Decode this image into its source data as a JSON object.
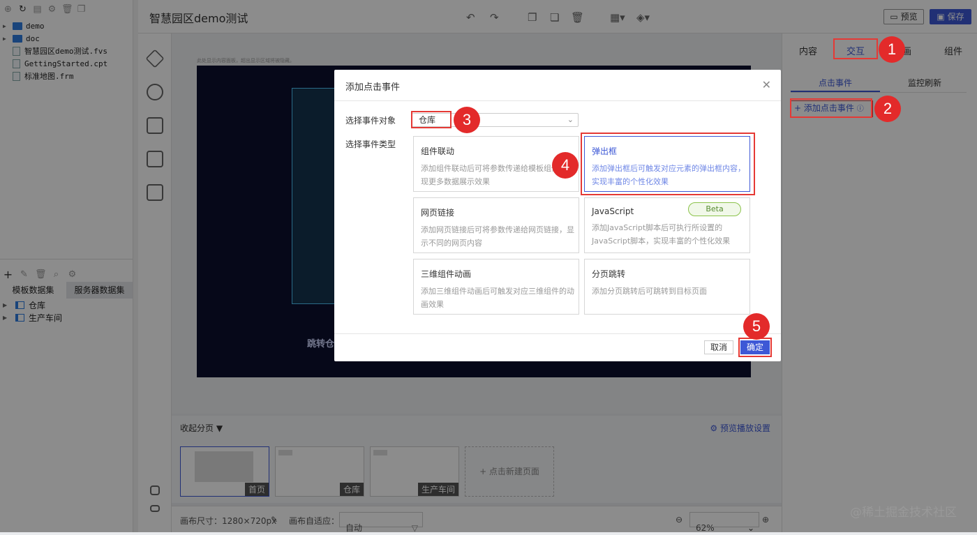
{
  "file_tree": [
    {
      "name": "demo",
      "type": "folder"
    },
    {
      "name": "doc",
      "type": "folder"
    },
    {
      "name": "智慧园区demo测试.fvs",
      "type": "file"
    },
    {
      "name": "GettingStarted.cpt",
      "type": "file"
    },
    {
      "name": "标准地图.frm",
      "type": "file"
    }
  ],
  "dataset_tabs": [
    "模板数据集",
    "服务器数据集"
  ],
  "datasets": [
    "仓库",
    "生产车间"
  ],
  "app_title": "智慧园区demo测试",
  "preview_label": "预览",
  "save_label": "保存",
  "canvas_hint": "此处显示内容面板，超出显示区域将被隐藏。",
  "canvas_button": "跳转仓",
  "pages": {
    "fold_label": "收起分页",
    "play_settings": "预览播放设置",
    "items": [
      "首页",
      "仓库",
      "生产车间"
    ],
    "new_page": "+ 点击新建页面"
  },
  "status": {
    "canvas_size": "画布尺寸：1280×720px",
    "auto_fit_label": "画布自适应：",
    "auto_fit_value": "自动",
    "zoom": "62%"
  },
  "right_panel": {
    "tabs": [
      "内容",
      "交互",
      "画",
      "组件"
    ],
    "sub_tabs": [
      "点击事件",
      "监控刷新"
    ],
    "add_event": "+ 添加点击事件"
  },
  "dialog": {
    "title": "添加点击事件",
    "target_label": "选择事件对象",
    "target_value": "仓库",
    "type_label": "选择事件类型",
    "cards": [
      {
        "title": "组件联动",
        "desc": "添加组件联动后可将参数传递给模板组件，实现更多数据展示效果"
      },
      {
        "title": "弹出框",
        "desc": "添加弹出框后可触发对应元素的弹出框内容，实现丰富的个性化效果"
      },
      {
        "title": "网页链接",
        "desc": "添加网页链接后可将参数传递给网页链接，显示不同的网页内容"
      },
      {
        "title": "JavaScript",
        "desc": "添加JavaScript脚本后可执行所设置的JavaScript脚本，实现丰富的个性化效果",
        "badge": "Beta"
      },
      {
        "title": "三维组件动画",
        "desc": "添加三维组件动画后可触发对应三维组件的动画效果"
      },
      {
        "title": "分页跳转",
        "desc": "添加分页跳转后可跳转到目标页面"
      }
    ],
    "cancel": "取消",
    "ok": "确定"
  },
  "annotations": [
    "1",
    "2",
    "3",
    "4",
    "5"
  ],
  "watermark": "@稀土掘金技术社区",
  "colors": {
    "accent": "#3d58d6",
    "annotation": "#e53935"
  }
}
